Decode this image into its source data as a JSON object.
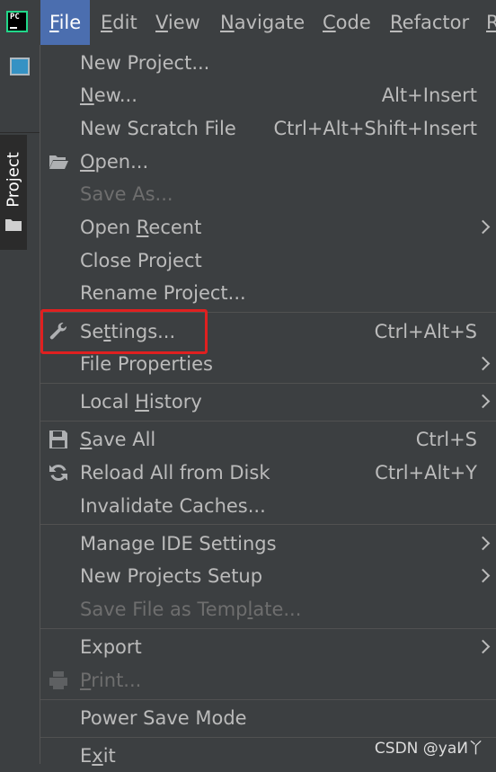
{
  "menubar": {
    "logo_text": "PC",
    "items": [
      {
        "pre": "",
        "mn": "F",
        "post": "ile"
      },
      {
        "pre": "",
        "mn": "E",
        "post": "dit"
      },
      {
        "pre": "",
        "mn": "V",
        "post": "iew"
      },
      {
        "pre": "",
        "mn": "N",
        "post": "avigate"
      },
      {
        "pre": "",
        "mn": "C",
        "post": "ode"
      },
      {
        "pre": "",
        "mn": "R",
        "post": "efactor"
      },
      {
        "pre": "",
        "mn": "R",
        "post": ""
      }
    ]
  },
  "sidebar": {
    "project_tab_label": "Project"
  },
  "file_menu": {
    "items": [
      {
        "pre": "New Project...",
        "mn": "",
        "post": "",
        "shortcut": ""
      },
      {
        "pre": "",
        "mn": "N",
        "post": "ew...",
        "shortcut": "Alt+Insert"
      },
      {
        "pre": "New Scratch File",
        "mn": "",
        "post": "",
        "shortcut": "Ctrl+Alt+Shift+Insert"
      },
      {
        "pre": "",
        "mn": "O",
        "post": "pen...",
        "shortcut": "",
        "icon": "folder-open-icon"
      },
      {
        "pre": "Save As...",
        "mn": "",
        "post": "",
        "shortcut": ""
      },
      {
        "pre": "Open ",
        "mn": "R",
        "post": "ecent",
        "shortcut": ""
      },
      {
        "pre": "Close Project",
        "mn": "",
        "post": "",
        "shortcut": ""
      },
      {
        "pre": "Rename Project...",
        "mn": "",
        "post": "",
        "shortcut": ""
      },
      {
        "pre": "Se",
        "mn": "t",
        "post": "tings...",
        "shortcut": "Ctrl+Alt+S",
        "icon": "wrench-icon"
      },
      {
        "pre": "File Properties",
        "mn": "",
        "post": "",
        "shortcut": ""
      },
      {
        "pre": "Local ",
        "mn": "H",
        "post": "istory",
        "shortcut": ""
      },
      {
        "pre": "",
        "mn": "S",
        "post": "ave All",
        "shortcut": "Ctrl+S",
        "icon": "save-icon"
      },
      {
        "pre": "Reload All from Disk",
        "mn": "",
        "post": "",
        "shortcut": "Ctrl+Alt+Y",
        "icon": "reload-icon"
      },
      {
        "pre": "Invalidate Caches...",
        "mn": "",
        "post": "",
        "shortcut": ""
      },
      {
        "pre": "Manage IDE Settings",
        "mn": "",
        "post": "",
        "shortcut": ""
      },
      {
        "pre": "New Projects Setup",
        "mn": "",
        "post": "",
        "shortcut": ""
      },
      {
        "pre": "Save File as Temp",
        "mn": "l",
        "post": "ate...",
        "shortcut": ""
      },
      {
        "pre": "Export",
        "mn": "",
        "post": "",
        "shortcut": ""
      },
      {
        "pre": "",
        "mn": "P",
        "post": "rint...",
        "shortcut": "",
        "icon": "print-icon"
      },
      {
        "pre": "Power Save Mode",
        "mn": "",
        "post": "",
        "shortcut": ""
      },
      {
        "pre": "E",
        "mn": "x",
        "post": "it",
        "shortcut": ""
      }
    ]
  },
  "watermark": "CSDN @yaИ丫",
  "colors": {
    "menu_bg": "#3c3f41",
    "selected_menu": "#4b6eaf",
    "text": "#bbbbbb",
    "disabled_text": "#6e6e6e",
    "highlight_border": "#e02020"
  }
}
